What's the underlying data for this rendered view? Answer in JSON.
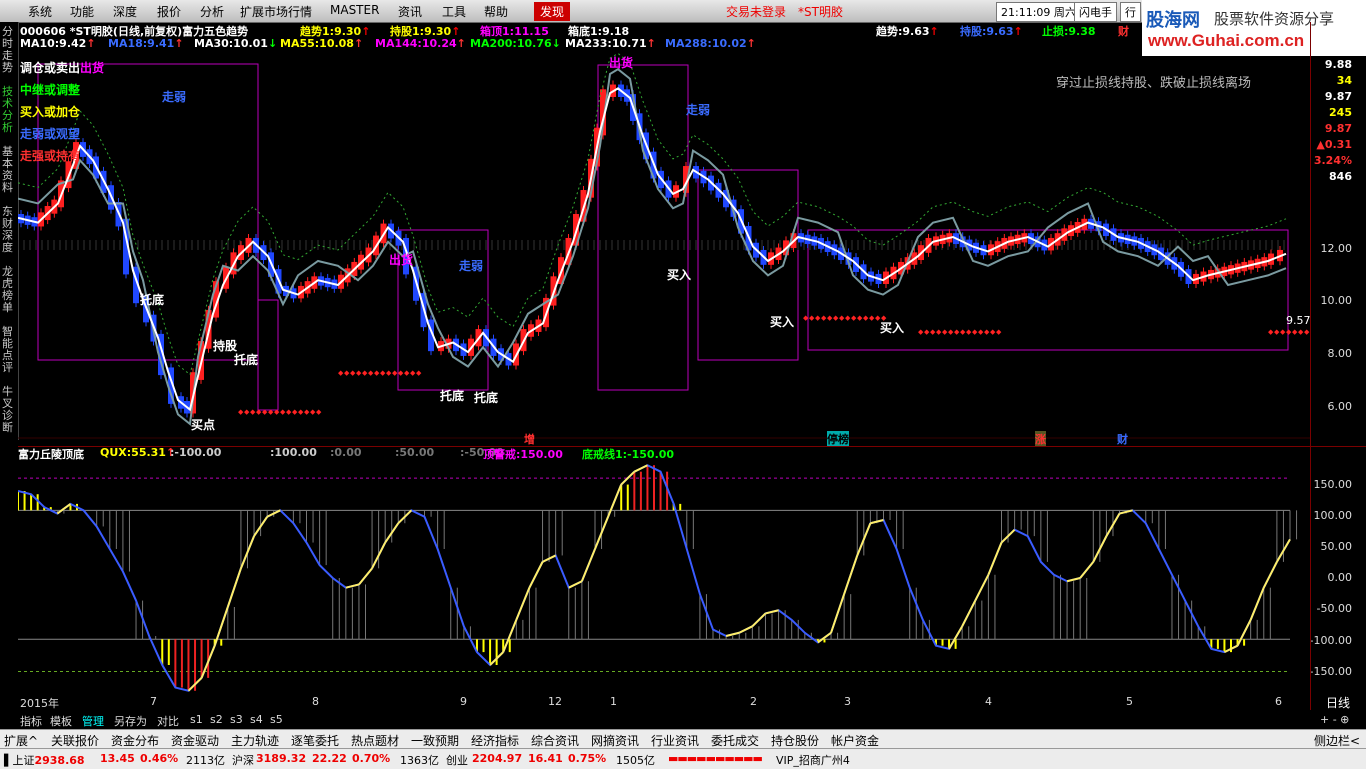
{
  "menu": {
    "items": [
      "系统",
      "功能",
      "深度",
      "报价",
      "分析",
      "扩展市场行情",
      "MASTER",
      "资讯",
      "工具",
      "帮助"
    ],
    "hot_item": "发现",
    "login_status": "交易未登录",
    "stock_short": "*ST明胶",
    "clock": "21:11:09 周六",
    "flash": "闪电手",
    "more": "行"
  },
  "logo": {
    "cn": "股海网",
    "sub": "股票软件资源分享",
    "url": "www.Guhai.com.cn"
  },
  "left_nav": [
    "分时走势",
    "技术分析",
    "基本资料",
    "东财深度",
    "龙虎榜单",
    "智能点评",
    "牛叉诊断"
  ],
  "info_row1": {
    "code_name": "000606 *ST明胶(日线,前复权)富力五色趋势",
    "items": [
      {
        "label": "趋势1:",
        "value": "9.30",
        "arrow": "↑",
        "color": "#ffff00"
      },
      {
        "label": "持股1:",
        "value": "9.30",
        "arrow": "↑",
        "color": "#ffff00"
      },
      {
        "label": "箱顶1:",
        "value": "11.15",
        "arrow": "",
        "color": "#ff00ff"
      },
      {
        "label": "箱底1:",
        "value": "9.18",
        "arrow": "",
        "color": "#ffffff"
      }
    ],
    "right_items": [
      {
        "label": "趋势:",
        "value": "9.63",
        "arrow": "↑",
        "color": "#ffffff"
      },
      {
        "label": "持股:",
        "value": "9.63",
        "arrow": "↑",
        "color": "#3a6cff"
      },
      {
        "label": "止损:",
        "value": "9.38",
        "arrow": "",
        "color": "#00ff00"
      },
      {
        "label": "财",
        "value": "",
        "arrow": "",
        "color": "#ff3030"
      }
    ]
  },
  "info_row2": [
    {
      "label": "MA10:",
      "value": "9.42",
      "arrow": "↑",
      "color": "#ffffff"
    },
    {
      "label": "MA18:",
      "value": "9.41",
      "arrow": "↑",
      "color": "#3a6cff"
    },
    {
      "label": "MA30:",
      "value": "10.01",
      "arrow": "↓",
      "color": "#ffffff"
    },
    {
      "label": "MA55:",
      "value": "10.08",
      "arrow": "↑",
      "color": "#ffff00"
    },
    {
      "label": "MA144:",
      "value": "10.24",
      "arrow": "↑",
      "color": "#ff00ff"
    },
    {
      "label": "MA200:",
      "value": "10.76",
      "arrow": "↓",
      "color": "#00ff00"
    },
    {
      "label": "MA233:",
      "value": "10.71",
      "arrow": "↑",
      "color": "#ffffff"
    },
    {
      "label": "MA288:",
      "value": "10.02",
      "arrow": "↑",
      "color": "#3a6cff"
    }
  ],
  "legend_box": [
    {
      "text": "调仓或卖出",
      "color": "#ffffff"
    },
    {
      "text": "中继或调整",
      "color": "#00ff00"
    },
    {
      "text": "买入或加仓",
      "color": "#ffff00"
    },
    {
      "text": "走弱或观望",
      "color": "#3a6cff"
    },
    {
      "text": "走强或持有",
      "color": "#ff3030"
    }
  ],
  "hint_text": "穿过止损线持股、跌破止损线离场",
  "price_labels": {
    "chuhuo": "出货",
    "zouruo": "走弱",
    "tuodi": "托底",
    "chigu": "持股",
    "maidian": "买点",
    "mairu": "买入",
    "zeng": "增",
    "tingbang": "停榜",
    "zhang": "涨",
    "cai": "财"
  },
  "price_axis": [
    "12.00",
    "10.00",
    "8.00",
    "6.00"
  ],
  "price_axis_top": [
    {
      "text": "9.88",
      "color": "#ffffff"
    },
    {
      "text": "34",
      "color": "#ffff00"
    },
    {
      "text": "9.87",
      "color": "#ffffff"
    },
    {
      "text": "245",
      "color": "#ffff00"
    },
    {
      "text": "9.87",
      "color": "#ff3030"
    },
    {
      "text": "▲0.31",
      "color": "#ff3030"
    },
    {
      "text": "3.24%",
      "color": "#ff3030"
    },
    {
      "text": "846",
      "color": "#ffffff"
    }
  ],
  "price_marker": "9.57",
  "ind_row": {
    "name": "富力丘陵顶底",
    "items": [
      {
        "label": "QUX:",
        "value": "55.31",
        "arrow": "↑",
        "color": "#ffff00"
      },
      {
        "label": ":",
        "value": "-100.00",
        "arrow": "",
        "color": "#cccccc"
      },
      {
        "label": ":",
        "value": "100.00",
        "arrow": "",
        "color": "#cccccc"
      },
      {
        "label": ":",
        "value": "0.00",
        "arrow": "",
        "color": "#777777"
      },
      {
        "label": ":",
        "value": "50.00",
        "arrow": "",
        "color": "#777777"
      },
      {
        "label": ":",
        "value": "-50.00",
        "arrow": "",
        "color": "#777777"
      },
      {
        "label": "顶警戒:",
        "value": "150.00",
        "arrow": "",
        "color": "#ff00ff"
      },
      {
        "label": "底戒线1:",
        "value": "-150.00",
        "arrow": "",
        "color": "#00ff00"
      }
    ]
  },
  "ind_axis": [
    "150.00",
    "100.00",
    "50.00",
    "0.00",
    "-50.00",
    "-100.00",
    "-150.00"
  ],
  "x_axis": [
    {
      "text": "2015年",
      "pos": 20
    },
    {
      "text": "7",
      "pos": 150
    },
    {
      "text": "8",
      "pos": 312
    },
    {
      "text": "9",
      "pos": 460
    },
    {
      "text": "12",
      "pos": 548
    },
    {
      "text": "1",
      "pos": 610
    },
    {
      "text": "2",
      "pos": 750
    },
    {
      "text": "3",
      "pos": 844
    },
    {
      "text": "4",
      "pos": 985
    },
    {
      "text": "5",
      "pos": 1126
    },
    {
      "text": "6",
      "pos": 1275
    }
  ],
  "period": "日线",
  "sub_tabs": [
    "指标",
    "模板",
    "管理",
    "另存为",
    "对比",
    "s1",
    "s2",
    "s3",
    "s4",
    "s5"
  ],
  "sub_tabs_active": "管理",
  "zoom_controls": "+ - ⊕",
  "func_tabs": [
    "扩展^",
    "关联报价",
    "资金分布",
    "资金驱动",
    "主力轨迹",
    "逐笔委托",
    "热点题材",
    "一致预期",
    "经济指标",
    "综合资讯",
    "网摘资讯",
    "行业资讯",
    "委托成交",
    "持仓股份",
    "帐户资金"
  ],
  "side_toggle": "侧边栏<",
  "status": {
    "sh": {
      "name": "上证",
      "price": "2938.68",
      "chg": "13.45",
      "pct": "0.46%",
      "amt": "2113亿"
    },
    "sz": {
      "name": "沪深",
      "price": "3189.32",
      "chg": "22.22",
      "pct": "0.70%",
      "amt": "1363亿"
    },
    "cy": {
      "name": "创业",
      "price": "2204.97",
      "chg": "16.41",
      "pct": "0.75%",
      "amt": "1505亿"
    },
    "vip": "VIP_招商广州4"
  },
  "chart_data": {
    "type": "candlestick",
    "price_ylim": [
      5.5,
      13.8
    ],
    "ind_ylim": [
      -185,
      175
    ],
    "qux_series": [
      130,
      125,
      105,
      95,
      110,
      100,
      75,
      40,
      5,
      -40,
      -95,
      -140,
      -175,
      -180,
      -160,
      -110,
      -50,
      10,
      60,
      90,
      100,
      80,
      50,
      15,
      -5,
      -20,
      -15,
      10,
      50,
      80,
      100,
      90,
      40,
      -20,
      -80,
      -120,
      -140,
      -120,
      -70,
      -20,
      20,
      30,
      -20,
      -10,
      40,
      90,
      140,
      160,
      170,
      160,
      110,
      40,
      -30,
      -85,
      -95,
      -90,
      -80,
      -60,
      -55,
      -70,
      -90,
      -105,
      -90,
      -30,
      30,
      80,
      85,
      40,
      -20,
      -70,
      -110,
      -115,
      -80,
      -40,
      0,
      50,
      70,
      60,
      20,
      0,
      -10,
      -5,
      20,
      60,
      95,
      100,
      80,
      40,
      0,
      -40,
      -80,
      -115,
      -120,
      -110,
      -70,
      -20,
      20,
      55
    ]
  }
}
